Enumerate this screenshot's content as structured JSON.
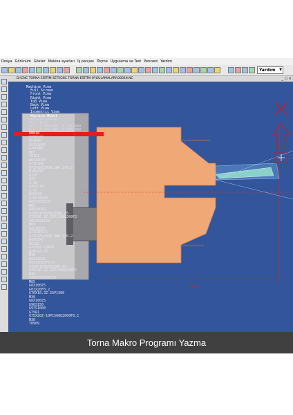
{
  "menu": [
    "Dosya",
    "Görünüm",
    "Göster",
    "Makina ayarları",
    "İş parçası",
    "Ölçme",
    "Uygulama ve Test",
    "Pencere",
    "Yardım"
  ],
  "toolbar": {
    "zoom_value": "Yardım"
  },
  "viewport_title": "D:\\CNC TORNA EĞİTİM SETİ\\CNC TORNA EĞİTİM UYGULAMALARI\\O0018.NC",
  "view_tree": [
    "Machine View",
    "Full Screen",
    "Front View",
    "Right View",
    "Top View",
    "Back View",
    "Left View",
    "Isometric View",
    "Machine Model"
  ],
  "selected_line": "O0018",
  "status_lines": [
    "Spindle Status",
    "Tool 10:5",
    "Act. X 400.000, Z 320.000",
    "Act. Z 400.000, Z 320.000"
  ],
  "program_lines": [
    "G0T0202",
    "G54G00",
    "G97S1000",
    "G28U0W0",
    "M03",
    "T0101",
    "G0X100Z5",
    "G71U1R1",
    "G71P10Q20U0.2W0.1F0.2",
    "N10G0X0",
    "G1Z0",
    "X20",
    "Z-10",
    "X30Z-20",
    "Z-35",
    "N20X42",
    "G70P10Q20",
    "G0X150Z150",
    "M05",
    "G0X100Z5",
    "G76P010060Q100R0.05",
    "G76X16.3Z-25P1300Q200F2",
    "G0X150Z150",
    "M05",
    "G0X100Z5",
    "G71U1R0.5",
    "G71P10Q20U0.3W0.1F0.2",
    "N10G0X0",
    "G01Z0",
    "G2X30Z-15R20",
    "N20G1Z-20",
    "M30",
    "G0X100Z5",
    "G01X20Z0F0.2",
    "G76P010060Q50R0.05",
    "G76X16.3Z-25P1300Q200F2",
    "M30",
    "G40G0X150Z150",
    "M05",
    "G0X100Z5",
    "G01X20F0.2",
    "G76X16.3Z-25P1300",
    "M30",
    "G0X100Z5",
    "G96S150",
    "G97S1000",
    "G75R1",
    "G75X20Z-10P1500Q2000F0.1",
    "M30",
    "T0909"
  ],
  "caption": "Torna Makro Programı Yazma",
  "colors": {
    "viewport_bg": "#32559b",
    "workpiece": "#f0a877",
    "selected": "#e21d1d",
    "caption_bg": "#404040"
  },
  "icons": [
    "new-icon",
    "open-icon",
    "save-icon",
    "zoom-in-icon",
    "zoom-out-icon",
    "rotate-icon",
    "cut-icon",
    "view-icon",
    "close-x-icon",
    "arrow-up-icon",
    "plus-icon"
  ]
}
